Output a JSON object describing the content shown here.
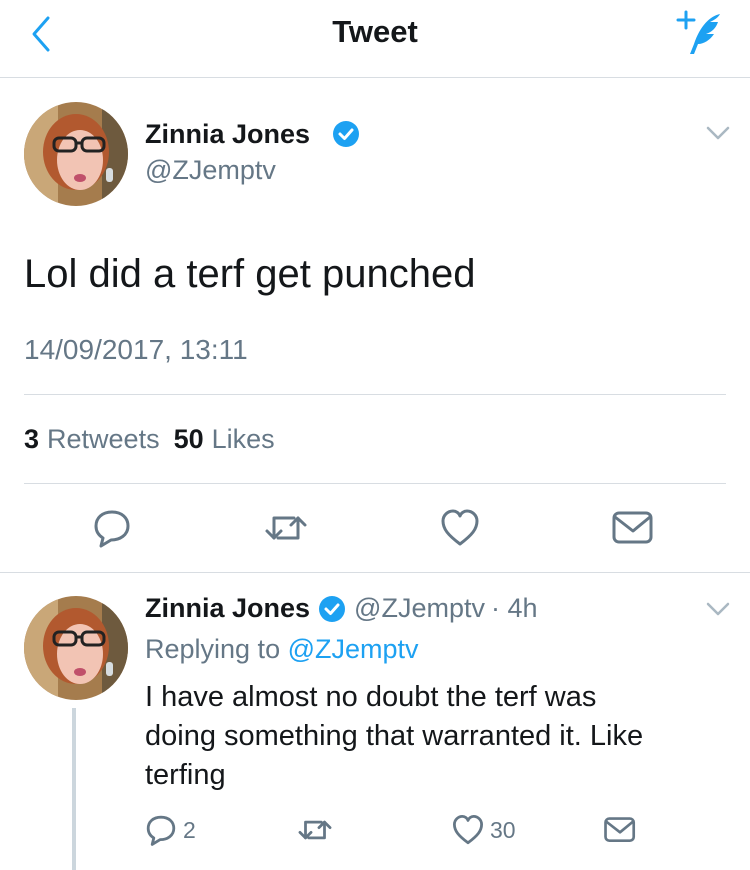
{
  "nav": {
    "title": "Tweet"
  },
  "tweet": {
    "author": {
      "name": "Zinnia Jones",
      "handle": "@ZJemptv"
    },
    "text": "Lol did a terf get punched",
    "timestamp": "14/09/2017, 13:11",
    "stats": {
      "retweets_count": "3",
      "retweets_label": "Retweets",
      "likes_count": "50",
      "likes_label": "Likes"
    }
  },
  "reply": {
    "author": {
      "name": "Zinnia Jones",
      "handle": "@ZJemptv"
    },
    "time": "· 4h",
    "replying_prefix": "Replying to",
    "replying_to": "@ZJemptv",
    "text_lines": [
      "I have almost no doubt the terf was",
      "doing something that warranted it. Like",
      "terfing"
    ],
    "counts": {
      "replies": "2",
      "likes": "30"
    }
  },
  "colors": {
    "accent": "#1da1f2",
    "text": "#14171a",
    "secondary": "#657786",
    "divider": "#d8dde2"
  },
  "icons": [
    "back-icon",
    "compose-icon",
    "verified-icon",
    "chevron-down-icon",
    "reply-icon",
    "retweet-icon",
    "like-icon",
    "message-icon"
  ]
}
